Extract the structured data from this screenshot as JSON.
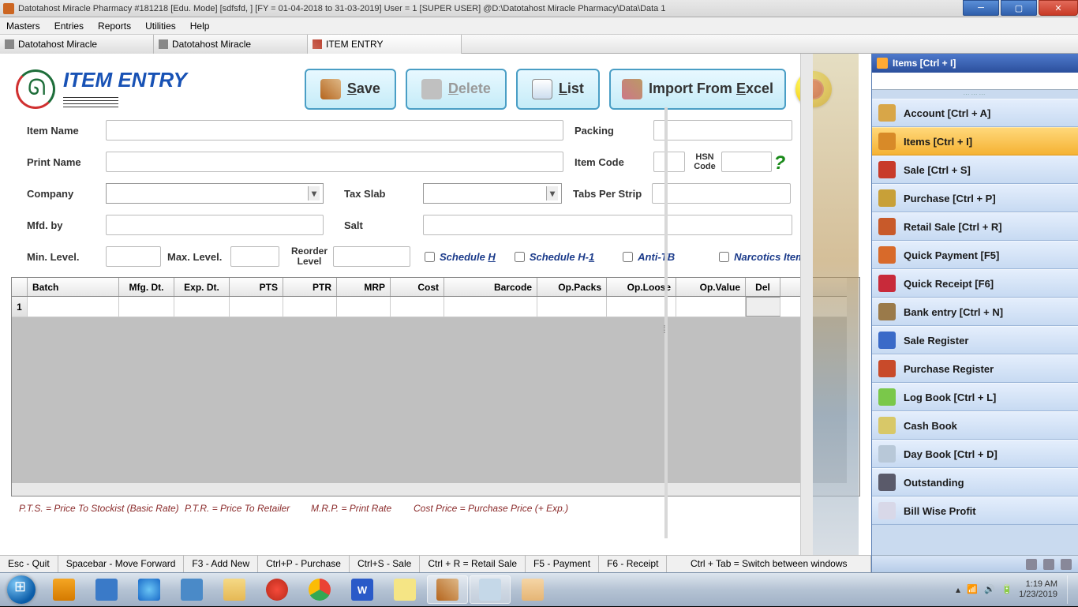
{
  "title": "Datotahost Miracle Pharmacy #181218  [Edu. Mode]  [sdfsfd, ] [FY = 01-04-2018 to 31-03-2019] User = 1 [SUPER USER]  @D:\\Datotahost Miracle Pharmacy\\Data\\Data 1",
  "menu": [
    "Masters",
    "Entries",
    "Reports",
    "Utilities",
    "Help"
  ],
  "tabs": [
    {
      "label": "Datotahost Miracle"
    },
    {
      "label": "Datotahost Miracle"
    },
    {
      "label": "ITEM ENTRY",
      "active": true
    }
  ],
  "page": {
    "heading": "ITEM ENTRY",
    "buttons": {
      "save": "Save",
      "delete": "Delete",
      "list": "List",
      "import": "Import From Excel"
    }
  },
  "form": {
    "item_name_lbl": "Item Name",
    "packing_lbl": "Packing",
    "print_name_lbl": "Print Name",
    "item_code_lbl": "Item Code",
    "hsn_lbl": "HSN Code",
    "company_lbl": "Company",
    "tax_slab_lbl": "Tax Slab",
    "tabs_per_strip_lbl": "Tabs Per Strip",
    "mfd_lbl": "Mfd. by",
    "salt_lbl": "Salt",
    "min_lbl": "Min. Level.",
    "max_lbl": "Max. Level.",
    "reorder_lbl": "Reorder Level",
    "schedule_h": "Schedule H",
    "schedule_h1": "Schedule H-1",
    "anti_tb": "Anti-TB",
    "narcotics": "Narcotics Item"
  },
  "grid": {
    "headers": [
      "Batch",
      "Mfg. Dt.",
      "Exp. Dt.",
      "PTS",
      "PTR",
      "MRP",
      "Cost",
      "Barcode",
      "Op.Packs",
      "Op.Loose",
      "Op.Value",
      "Del"
    ],
    "rownum": "1"
  },
  "footnote": {
    "pts": "P.T.S. = Price To Stockist (Basic Rate)",
    "ptr": "P.T.R. = Price To Retailer",
    "mrp": "M.R.P.  = Print Rate",
    "cost": "Cost Price =  Purchase Price (+ Exp.)"
  },
  "shortcuts": [
    "Esc - Quit",
    "Spacebar - Move Forward",
    "F3 - Add New",
    "Ctrl+P - Purchase",
    "Ctrl+S - Sale",
    "Ctrl + R = Retail Sale",
    "F5 - Payment",
    "F6 - Receipt",
    "Ctrl + Tab = Switch between windows"
  ],
  "rightpanel": {
    "title": "Items [Ctrl + I]",
    "items": [
      {
        "label": "Account [Ctrl + A]",
        "color": "#d8a648"
      },
      {
        "label": "Items [Ctrl + I]",
        "color": "#d88a28",
        "active": true
      },
      {
        "label": "Sale [Ctrl + S]",
        "color": "#c83a2a"
      },
      {
        "label": "Purchase [Ctrl + P]",
        "color": "#c8a038"
      },
      {
        "label": "Retail Sale [Ctrl + R]",
        "color": "#c85a2a"
      },
      {
        "label": "Quick Payment [F5]",
        "color": "#d86a2a"
      },
      {
        "label": "Quick Receipt [F6]",
        "color": "#c82a3a"
      },
      {
        "label": "Bank entry [Ctrl + N]",
        "color": "#9a7a4a"
      },
      {
        "label": "Sale Register",
        "color": "#3a6ac8"
      },
      {
        "label": "Purchase Register",
        "color": "#c84a2a"
      },
      {
        "label": "Log Book [Ctrl + L]",
        "color": "#7ac84a"
      },
      {
        "label": "Cash Book",
        "color": "#d8c868"
      },
      {
        "label": "Day Book [Ctrl + D]",
        "color": "#b8c8d8"
      },
      {
        "label": "Outstanding",
        "color": "#5a5a6a"
      },
      {
        "label": "Bill Wise Profit",
        "color": "#d8d8e8"
      }
    ]
  },
  "tray": {
    "time": "1:19 AM",
    "date": "1/23/2019"
  }
}
